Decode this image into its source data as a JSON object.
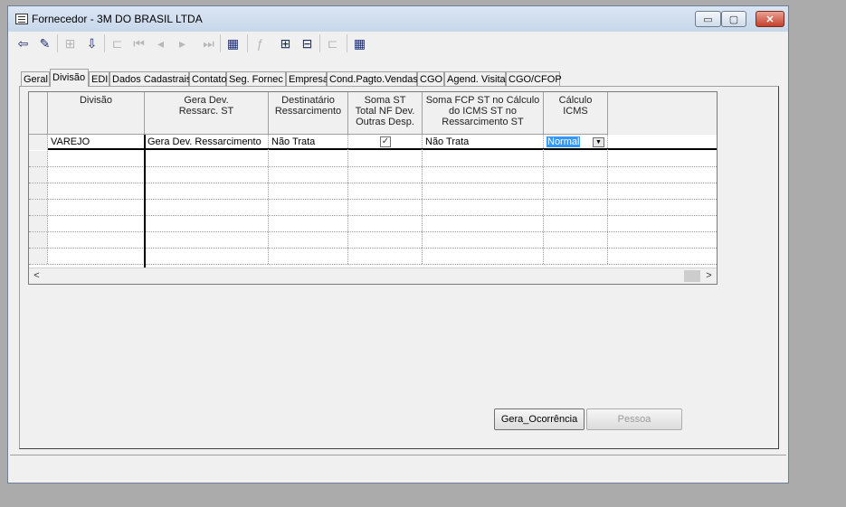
{
  "window": {
    "title": "Fornecedor - 3M DO BRASIL LTDA",
    "controls": {
      "minimize": "▭",
      "maximize": "▢",
      "close": "✕"
    }
  },
  "toolbar": [
    {
      "name": "exit-icon",
      "glyph": "⇦",
      "enabled": true
    },
    {
      "name": "edit-icon",
      "glyph": "✎",
      "enabled": true
    },
    {
      "name": "insert-icon",
      "glyph": "⊞",
      "enabled": false
    },
    {
      "name": "save-icon",
      "glyph": "⇩",
      "enabled": true
    },
    {
      "name": "tree-icon",
      "glyph": "⊏",
      "enabled": false
    },
    {
      "name": "first-icon",
      "glyph": "⏮",
      "enabled": false
    },
    {
      "name": "prev-icon",
      "glyph": "◂",
      "enabled": false
    },
    {
      "name": "next-icon",
      "glyph": "▸",
      "enabled": false
    },
    {
      "name": "last-icon",
      "glyph": "⏭",
      "enabled": false
    },
    {
      "name": "grid-icon",
      "glyph": "▦",
      "enabled": true
    },
    {
      "name": "filter-icon",
      "glyph": "ƒ",
      "enabled": false
    },
    {
      "name": "add-row-icon",
      "glyph": "⊞",
      "enabled": true
    },
    {
      "name": "delete-row-icon",
      "glyph": "⊟",
      "enabled": true
    },
    {
      "name": "link-icon",
      "glyph": "⊏",
      "enabled": false
    },
    {
      "name": "table-star-icon",
      "glyph": "▦",
      "enabled": true
    }
  ],
  "tabs": [
    "Geral",
    "Divisão",
    "EDI",
    "Dados Cadastrais",
    "Contato",
    "Seg. Fornec",
    "Empresa",
    "Cond.Pagto.Vendas",
    "CGO",
    "Agend. Visita",
    "CGO/CFOP"
  ],
  "active_tab": "Divisão",
  "grid": {
    "headers": [
      "Divisão",
      "Gera Dev.\nRessarc. ST",
      "Destinatário\nRessarcimento",
      "Soma ST\nTotal NF Dev.\nOutras Desp.",
      "Soma FCP ST no Cálculo\ndo ICMS ST no\nRessarcimento ST",
      "Cálculo\nICMS"
    ],
    "rows": [
      {
        "divisao": "VAREJO",
        "gera_dev": "Gera Dev. Ressarcimento",
        "destinatario": "Não Trata",
        "soma_st": true,
        "soma_fcp": "Não Trata",
        "calculo_icms": "Normal"
      }
    ],
    "empty_rows": 7,
    "scroll": {
      "left": "<",
      "right": ">"
    }
  },
  "buttons": {
    "gera_ocorrencia": "Gera_Ocorrência",
    "pessoa": "Pessoa"
  }
}
